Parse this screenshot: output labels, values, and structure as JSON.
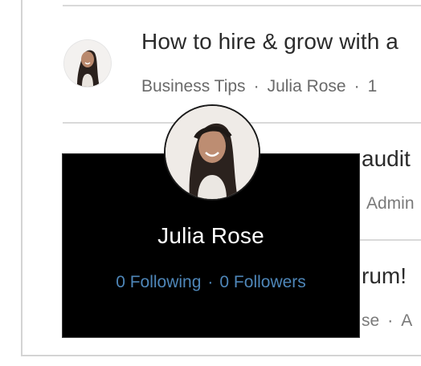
{
  "posts": [
    {
      "title": "How to hire & grow with a",
      "category": "Business Tips",
      "author": "Julia Rose",
      "time": "1"
    },
    {
      "title_fragment": "audit",
      "meta_fragment": "Admin"
    },
    {
      "title_fragment": "rum!",
      "meta_author_fragment": "se",
      "meta_time_fragment": "A"
    }
  ],
  "separator": "·",
  "hover_card": {
    "name": "Julia Rose",
    "following": "0 Following",
    "followers": "0 Followers"
  },
  "colors": {
    "card_background": "#000000",
    "stats_link": "#4e86b8",
    "divider": "#d9d9d9"
  },
  "icons": {
    "post_avatar": "profile-photo-icon",
    "card_avatar": "profile-photo-icon"
  }
}
